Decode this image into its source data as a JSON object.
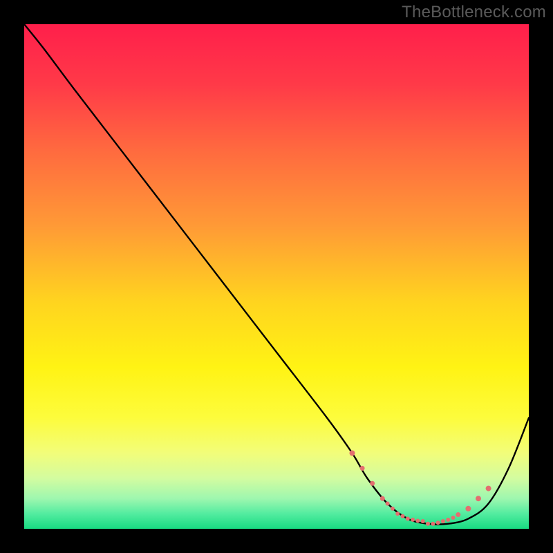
{
  "watermark": "TheBottleneck.com",
  "chart_data": {
    "type": "line",
    "title": "",
    "xlabel": "",
    "ylabel": "",
    "xlim": [
      0,
      100
    ],
    "ylim": [
      0,
      100
    ],
    "series": [
      {
        "name": "bottleneck-curve",
        "color": "#000000",
        "x": [
          0,
          4,
          10,
          20,
          30,
          40,
          50,
          60,
          65,
          68,
          72,
          76,
          80,
          84,
          88,
          92,
          96,
          100
        ],
        "y": [
          100,
          95,
          87,
          74,
          61,
          48,
          35,
          22,
          15,
          10,
          5,
          2,
          1,
          1,
          2,
          5,
          12,
          22
        ]
      }
    ],
    "markers": {
      "name": "dotted-valley",
      "color": "#e36f6f",
      "x": [
        65,
        67,
        69,
        71,
        72,
        73,
        74,
        75,
        76,
        77,
        78,
        79,
        80,
        81,
        82,
        83,
        84,
        85,
        86,
        88,
        90,
        92
      ],
      "y": [
        15,
        12,
        9,
        6,
        5,
        4,
        3,
        2.5,
        2,
        1.8,
        1.6,
        1.5,
        1,
        1,
        1.2,
        1.5,
        1.8,
        2.2,
        2.8,
        4,
        6,
        8
      ],
      "radius": [
        4,
        3.5,
        3.5,
        3.5,
        3,
        3,
        3,
        3,
        3,
        3,
        3,
        3,
        3,
        3,
        3,
        3,
        3,
        3,
        3.5,
        4,
        4,
        4
      ]
    },
    "gradient_stops": [
      {
        "offset": 0.0,
        "color": "#ff1f4b"
      },
      {
        "offset": 0.12,
        "color": "#ff3a48"
      },
      {
        "offset": 0.25,
        "color": "#ff6a3f"
      },
      {
        "offset": 0.4,
        "color": "#ff9a36"
      },
      {
        "offset": 0.55,
        "color": "#ffd41f"
      },
      {
        "offset": 0.68,
        "color": "#fff314"
      },
      {
        "offset": 0.78,
        "color": "#fdfc3c"
      },
      {
        "offset": 0.85,
        "color": "#f2fd7a"
      },
      {
        "offset": 0.9,
        "color": "#d3fca0"
      },
      {
        "offset": 0.94,
        "color": "#9ef7af"
      },
      {
        "offset": 0.97,
        "color": "#53eca0"
      },
      {
        "offset": 1.0,
        "color": "#18db82"
      }
    ]
  }
}
